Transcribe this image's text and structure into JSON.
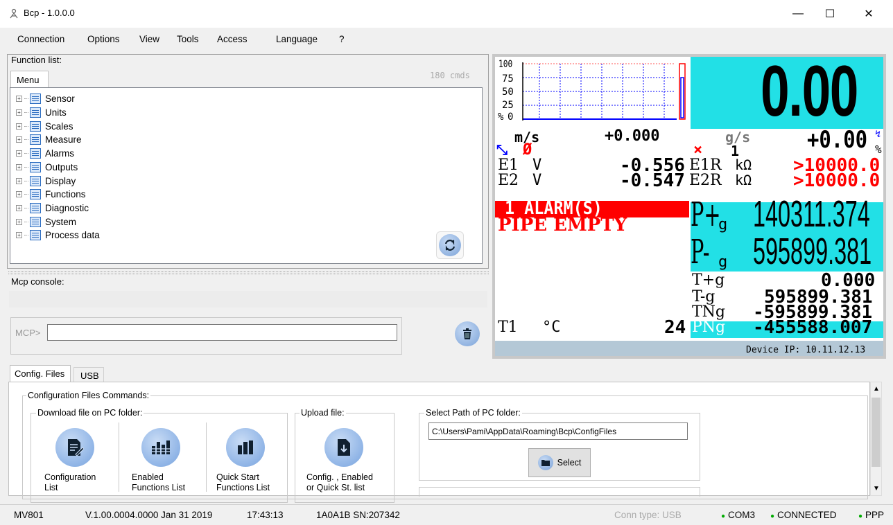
{
  "window": {
    "title": "Bcp - 1.0.0.0",
    "controls": {
      "minimize": "—",
      "maximize": "☐",
      "close": "✕"
    }
  },
  "menubar": {
    "items": [
      "Connection",
      "Options",
      "View",
      "Tools",
      "Access",
      "Language",
      "?"
    ]
  },
  "function_list": {
    "label": "Function list:",
    "tab": "Menu",
    "count": "180 cmds",
    "items": [
      "Sensor",
      "Units",
      "Scales",
      "Measure",
      "Alarms",
      "Outputs",
      "Display",
      "Functions",
      "Diagnostic",
      "System",
      "Process data"
    ]
  },
  "console": {
    "label": "Mcp console:",
    "prompt": "MCP>",
    "input_value": ""
  },
  "display": {
    "main_value": "0.00",
    "bar_labels": [
      "100",
      "75",
      "50",
      "25",
      "0"
    ],
    "bar_unit": "%",
    "flow_unit": "m/s",
    "flow_value": "+0.000",
    "mass_unit": "g/s",
    "mass_value": "+0.00",
    "mass_suffix": "%",
    "alarm_count_small": "1",
    "e1_label": "E1",
    "e1_unit": "V",
    "e1_value": "-0.556",
    "e1r_label": "E1R",
    "e1r_unit": "kΩ",
    "e1r_value": ">10000.0",
    "e2_label": "E2",
    "e2_unit": "V",
    "e2_value": "-0.547",
    "e2r_label": "E2R",
    "e2r_unit": "kΩ",
    "e2r_value": ">10000.0",
    "alarm_text": "1 ALARM(S)",
    "pipe_text": "PIPE EMPTY",
    "p_plus_label": "P+",
    "p_plus_sub": "g",
    "p_plus_value": "140311.374",
    "p_minus_label": "P-",
    "p_minus_sub": "g",
    "p_minus_value": "595899.381",
    "t_plus_label": "T+g",
    "t_plus_value": "0.000",
    "t_minus_label": "T-g",
    "t_minus_value": "595899.381",
    "tn_label": "TNg",
    "tn_value": "-595899.381",
    "pn_label": "PNg",
    "pn_value": "-455588.007",
    "t1_label": "T1",
    "t1_unit": "°C",
    "t1_value": "24",
    "device_ip": "Device IP: 10.11.12.13",
    "colors": {
      "cyan": "#22e0e6",
      "red": "#ff0000",
      "blue": "#0000ff",
      "grey": "#b4c8d6"
    }
  },
  "bottom": {
    "tabs": [
      "Config. Files",
      "USB"
    ],
    "commands_label": "Configuration Files Commands:",
    "download_label": "Download file on PC folder:",
    "upload_label": "Upload file:",
    "path_label": "Select Path of PC folder:",
    "path_value": "C:\\Users\\Pami\\AppData\\Roaming\\Bcp\\ConfigFiles",
    "select_button": "Select",
    "buttons": [
      {
        "line1": "Configuration",
        "line2": "List"
      },
      {
        "line1": "Enabled",
        "line2": "Functions List"
      },
      {
        "line1": "Quick Start",
        "line2": "Functions List"
      },
      {
        "line1": "Config. , Enabled",
        "line2": "or Quick St. list"
      }
    ]
  },
  "statusbar": {
    "model": "MV801",
    "version": "V.1.00.0004.0000 Jan 31 2019",
    "time": "17:43:13",
    "serial": "1A0A1B SN:207342",
    "conn_type": "Conn type: USB",
    "port": "COM3",
    "state": "CONNECTED",
    "ppp": "PPP"
  }
}
